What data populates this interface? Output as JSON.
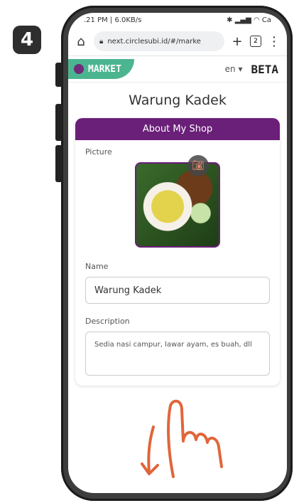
{
  "step_number": "4",
  "status_bar": {
    "left": ".21 PM | 6.0KB/s",
    "right": "Ca"
  },
  "browser": {
    "url": "next.circlesubi.id/#/marke",
    "tab_count": "2"
  },
  "app": {
    "brand": "MARKET",
    "language": "en",
    "beta_label": "BETA",
    "shop_name_title": "Warung Kadek"
  },
  "card": {
    "header": "About My Shop",
    "picture_label": "Picture",
    "name_label": "Name",
    "name_value": "Warung Kadek",
    "description_label": "Description",
    "description_value": "Sedia nasi campur, lawar ayam, es buah, dll"
  },
  "colors": {
    "brand_green": "#4bb590",
    "header_purple": "#6a1f78",
    "gesture_orange": "#e0663a"
  }
}
